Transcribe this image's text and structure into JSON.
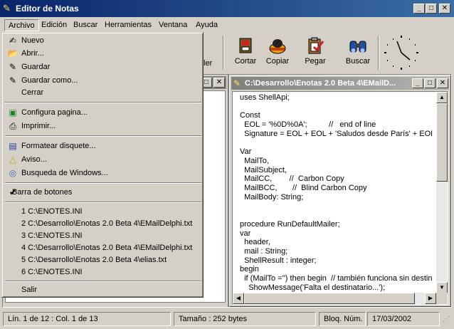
{
  "window": {
    "title": "Editor de Notas"
  },
  "menubar": [
    "Archivo",
    "Edición",
    "Buscar",
    "Herramientas",
    "Ventana",
    "Ayuda"
  ],
  "toolbar": {
    "partial_label": "ler",
    "cut": "Cortar",
    "copy": "Copiar",
    "paste": "Pegar",
    "search": "Buscar"
  },
  "file_menu": {
    "new": "Nuevo",
    "open": "Abrir...",
    "save": "Guardar",
    "save_as": "Guardar como...",
    "close": "Cerrar",
    "page_setup": "Configura pagina...",
    "print": "Imprimir...",
    "format_floppy": "Formatear disquete...",
    "notice": "Aviso...",
    "windows_search": "Busqueda de Windows...",
    "button_bar": "Barra de botones",
    "recent": [
      "1 C:\\ENOTES.INI",
      "2 C:\\Desarrollo\\Enotas 2.0 Beta 4\\EMailDelphi.txt",
      "3 C:\\ENOTES.INI",
      "4 C:\\Desarrollo\\Enotas 2.0 Beta 4\\EMailDelphi.txt",
      "5 C:\\Desarrollo\\Enotas 2.0 Beta 4\\elias.txt",
      "6 C:\\ENOTES.INI"
    ],
    "exit": "Salir"
  },
  "editor": {
    "title": "C:\\Desarrollo\\Enotas 2.0 Beta 4\\EMailD...",
    "text": "uses ShellApi;\n\nConst\n  EOL = '%0D%0A';          //   end of line\n  Signature = EOL + EOL + 'Saludos desde París' + EOL +\n\nVar\n  MailTo,\n  MailSubject,\n  MailCC,        //  Carbon Copy\n  MailBCC,       //  Blind Carbon Copy\n  MailBody: String;\n\n\nprocedure RunDefaultMailer;\nvar\n  header,\n  mail : String;\n  ShellResult : integer;\nbegin\n  if (MailTo ='') then begin  // también funciona sin destina\n    ShowMessage('Falta el destinatario...');"
  },
  "statusbar": {
    "position": "Lín.  1 de 12 : Col.  1 de 13",
    "size": "Tamaño : 252 bytes",
    "numlock": "Bloq. Núm.",
    "date": "17/03/2002"
  }
}
